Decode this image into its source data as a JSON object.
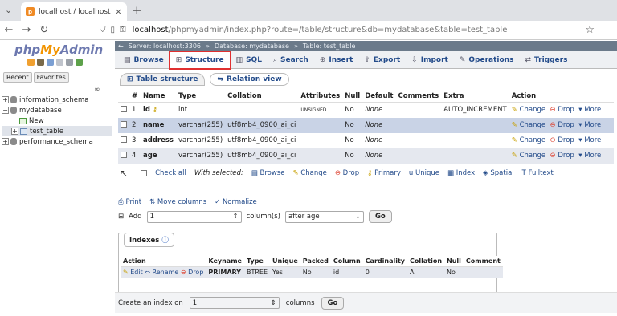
{
  "browser": {
    "tab_title": "localhost / localhost / my",
    "tab_close": "×",
    "new_tab": "+",
    "url_host": "localhost",
    "url_rest": "/phpmyadmin/index.php?route=/table/structure&db=mydatabase&table=test_table"
  },
  "nav": {
    "logo_php": "php",
    "logo_my": "My",
    "logo_admin": "Admin",
    "tab_recent": "Recent",
    "tab_favorites": "Favorites",
    "tree": {
      "information_schema": "information_schema",
      "mydatabase": "mydatabase",
      "new": "New",
      "test_table": "test_table",
      "performance_schema": "performance_schema"
    }
  },
  "breadcrumb": {
    "server": "Server: localhost:3306",
    "database": "Database: mydatabase",
    "table": "Table: test_table"
  },
  "menu": {
    "browse": "Browse",
    "structure": "Structure",
    "sql": "SQL",
    "search": "Search",
    "insert": "Insert",
    "export": "Export",
    "import": "Import",
    "operations": "Operations",
    "triggers": "Triggers"
  },
  "subtabs": {
    "table_structure": "Table structure",
    "relation_view": "Relation view"
  },
  "columns_table": {
    "headers": {
      "num": "#",
      "name": "Name",
      "type": "Type",
      "collation": "Collation",
      "attributes": "Attributes",
      "null": "Null",
      "default": "Default",
      "comments": "Comments",
      "extra": "Extra",
      "action": "Action"
    },
    "rows": [
      {
        "num": "1",
        "name": "id",
        "type": "int",
        "collation": "",
        "attributes": "UNSIGNED",
        "null": "No",
        "default": "None",
        "comments": "",
        "extra": "AUTO_INCREMENT"
      },
      {
        "num": "2",
        "name": "name",
        "type": "varchar(255)",
        "collation": "utf8mb4_0900_ai_ci",
        "attributes": "",
        "null": "No",
        "default": "None",
        "comments": "",
        "extra": ""
      },
      {
        "num": "3",
        "name": "address",
        "type": "varchar(255)",
        "collation": "utf8mb4_0900_ai_ci",
        "attributes": "",
        "null": "No",
        "default": "None",
        "comments": "",
        "extra": ""
      },
      {
        "num": "4",
        "name": "age",
        "type": "varchar(255)",
        "collation": "utf8mb4_0900_ai_ci",
        "attributes": "",
        "null": "No",
        "default": "None",
        "comments": "",
        "extra": ""
      }
    ],
    "action_change": "Change",
    "action_drop": "Drop",
    "action_more": "More"
  },
  "bulk": {
    "check_all": "Check all",
    "with_selected": "With selected:",
    "browse": "Browse",
    "change": "Change",
    "drop": "Drop",
    "primary": "Primary",
    "unique": "Unique",
    "index": "Index",
    "spatial": "Spatial",
    "fulltext": "Fulltext"
  },
  "tools": {
    "print": "Print",
    "move_columns": "Move columns",
    "normalize": "Normalize",
    "add_label": "Add",
    "add_value": "1",
    "columns_label": "column(s)",
    "position_value": "after age",
    "go": "Go"
  },
  "indexes": {
    "legend": "Indexes",
    "headers": {
      "action": "Action",
      "keyname": "Keyname",
      "type": "Type",
      "unique": "Unique",
      "packed": "Packed",
      "column": "Column",
      "cardinality": "Cardinality",
      "collation": "Collation",
      "null": "Null",
      "comment": "Comment"
    },
    "row": {
      "edit": "Edit",
      "rename": "Rename",
      "drop": "Drop",
      "keyname": "PRIMARY",
      "type": "BTREE",
      "unique": "Yes",
      "packed": "No",
      "column": "id",
      "cardinality": "0",
      "collation": "A",
      "null": "No",
      "comment": ""
    }
  },
  "create_index": {
    "label": "Create an index on",
    "value": "1",
    "columns_label": "columns",
    "go": "Go"
  },
  "colors": {
    "link": "#234b8a",
    "breadcrumb_bg": "#6b7a8a",
    "highlight_outline": "#e03030",
    "row_alt": "#e5e8ef"
  }
}
